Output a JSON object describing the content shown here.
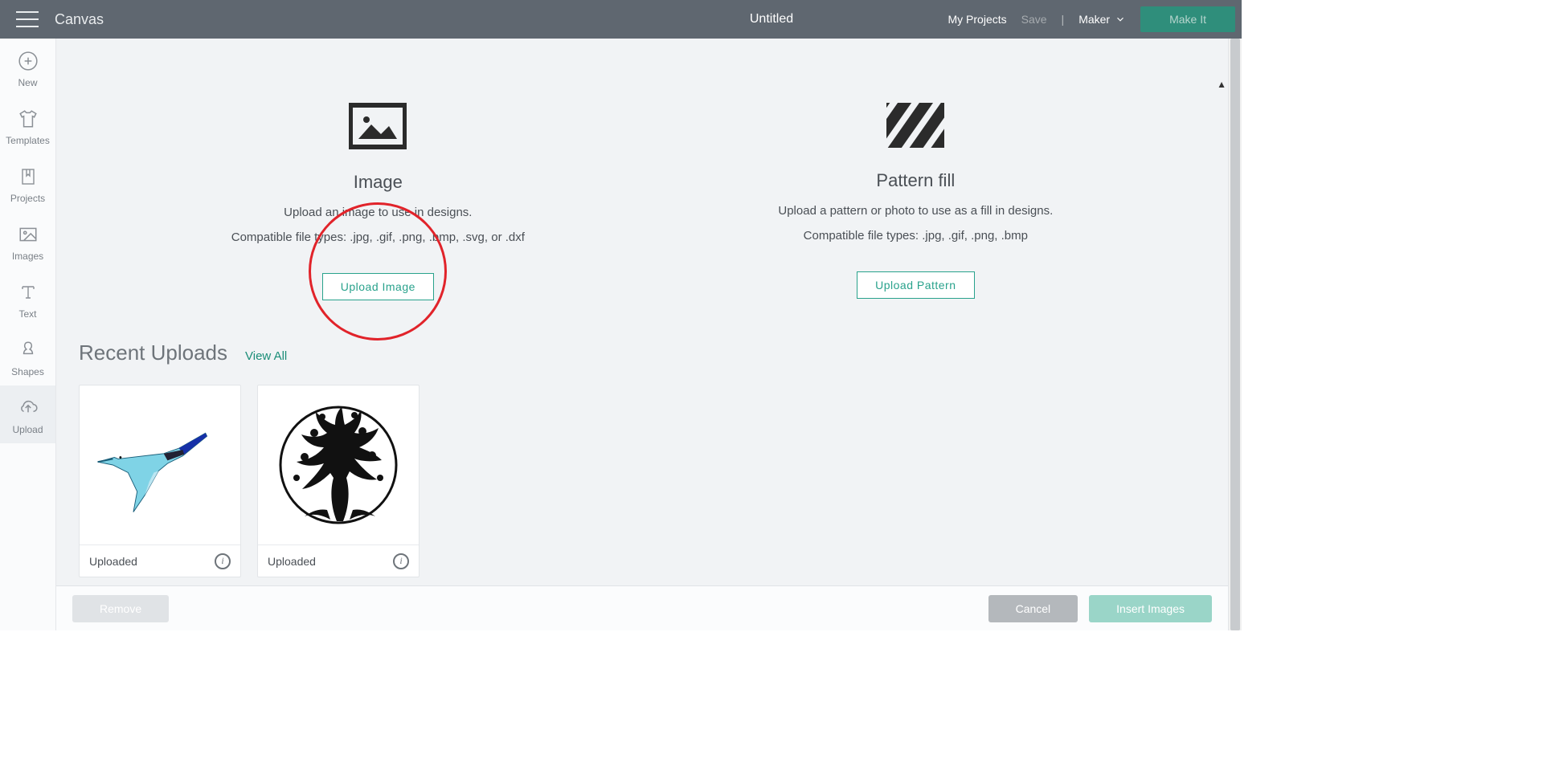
{
  "header": {
    "brand": "Canvas",
    "title": "Untitled",
    "my_projects": "My Projects",
    "save": "Save",
    "machine": "Maker",
    "make_it": "Make It"
  },
  "sidebar": {
    "items": [
      {
        "label": "New"
      },
      {
        "label": "Templates"
      },
      {
        "label": "Projects"
      },
      {
        "label": "Images"
      },
      {
        "label": "Text"
      },
      {
        "label": "Shapes"
      },
      {
        "label": "Upload"
      }
    ]
  },
  "upload": {
    "image": {
      "title": "Image",
      "desc": "Upload an image to use in designs.",
      "types": "Compatible file types: .jpg, .gif, .png, .bmp, .svg, or .dxf",
      "button": "Upload Image"
    },
    "pattern": {
      "title": "Pattern fill",
      "desc": "Upload a pattern or photo to use as a fill in designs.",
      "types": "Compatible file types: .jpg, .gif, .png, .bmp",
      "button": "Upload Pattern"
    }
  },
  "recent": {
    "title": "Recent Uploads",
    "view_all": "View All",
    "items": [
      {
        "status": "Uploaded",
        "kind": "hummingbird"
      },
      {
        "status": "Uploaded",
        "kind": "tree"
      }
    ]
  },
  "footer": {
    "remove": "Remove",
    "cancel": "Cancel",
    "insert": "Insert Images"
  }
}
